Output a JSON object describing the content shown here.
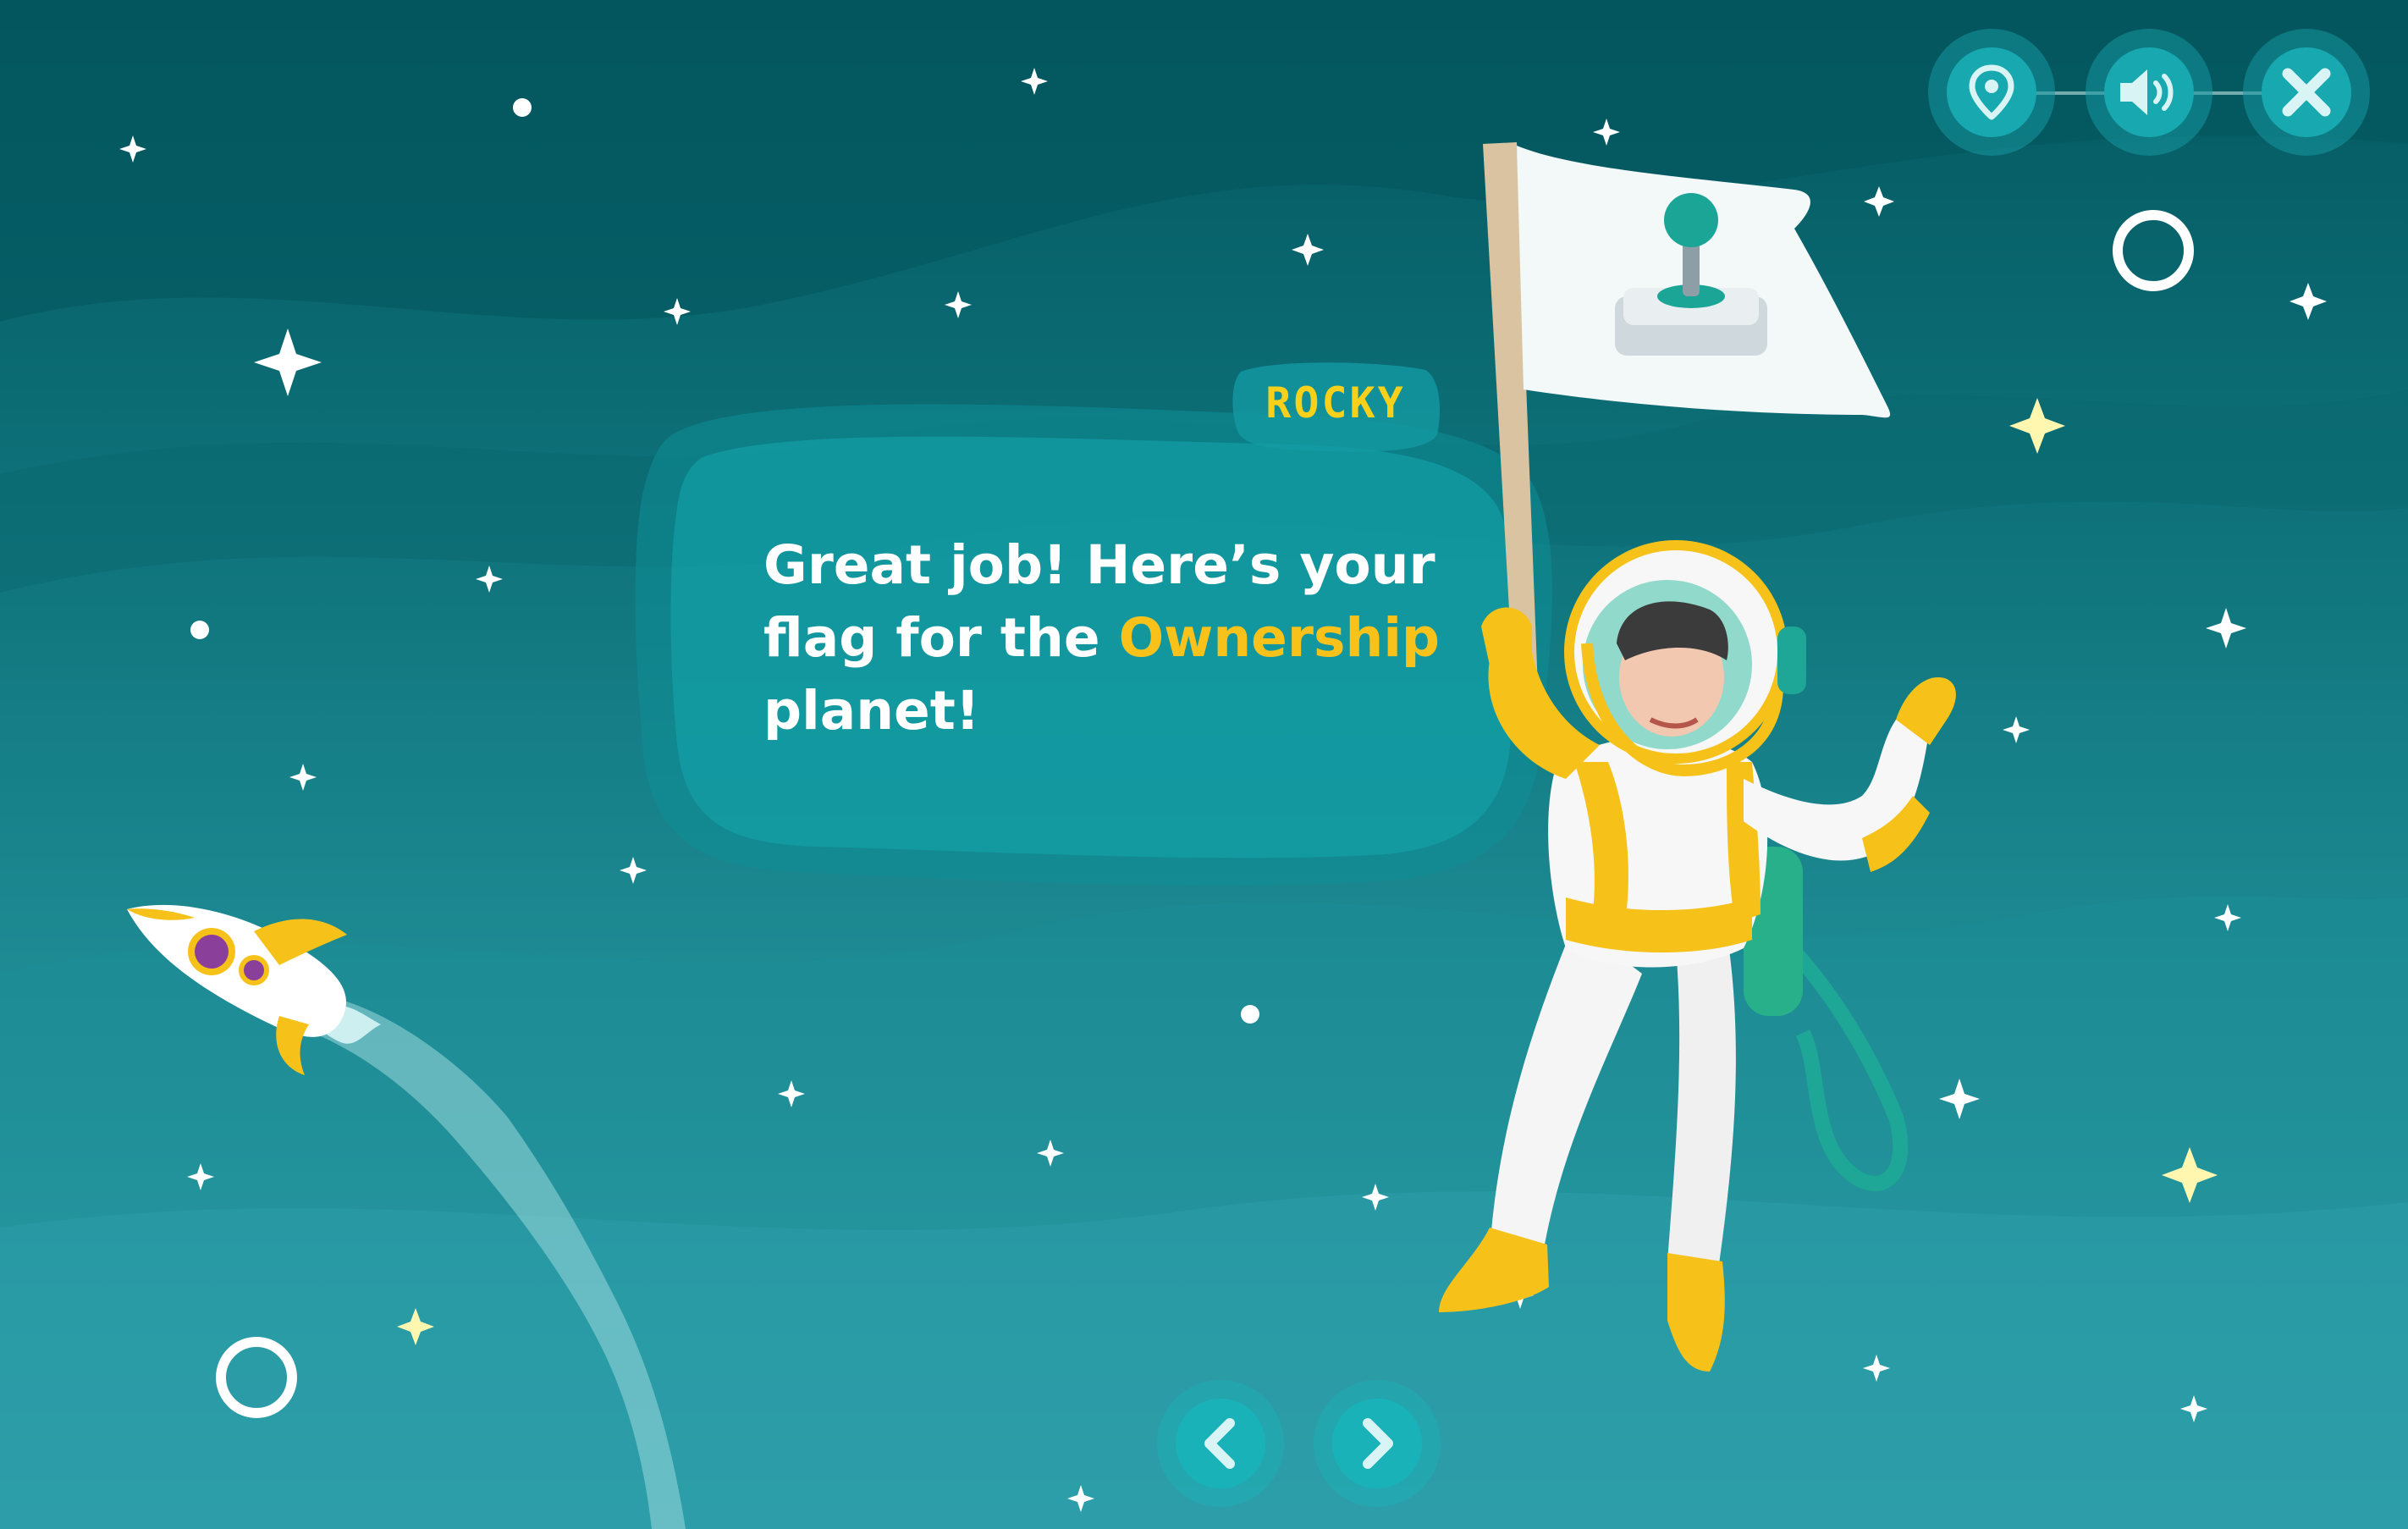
{
  "scene": {
    "title": "",
    "speaker": {
      "name": "ROCKY"
    },
    "dialogue": {
      "before": "Great job! Here’s your flag for the ",
      "highlight": "Ownership",
      "after": " planet!"
    }
  },
  "controls": {
    "map": {
      "icon": "map-pin-icon"
    },
    "sound": {
      "icon": "speaker-icon"
    },
    "close": {
      "icon": "close-icon"
    }
  },
  "navigation": {
    "prev": {
      "icon": "chevron-left-icon"
    },
    "next": {
      "icon": "chevron-right-icon"
    }
  },
  "illustration": {
    "character": "astronaut",
    "flag_emblem": "joystick-icon",
    "rocket": "rocket-icon"
  },
  "colors": {
    "highlight": "#f9c21b",
    "speaker": "#f6d01b",
    "button": "#17a8b0",
    "background_top": "#04575f",
    "background_bottom": "#3aa8b4"
  }
}
